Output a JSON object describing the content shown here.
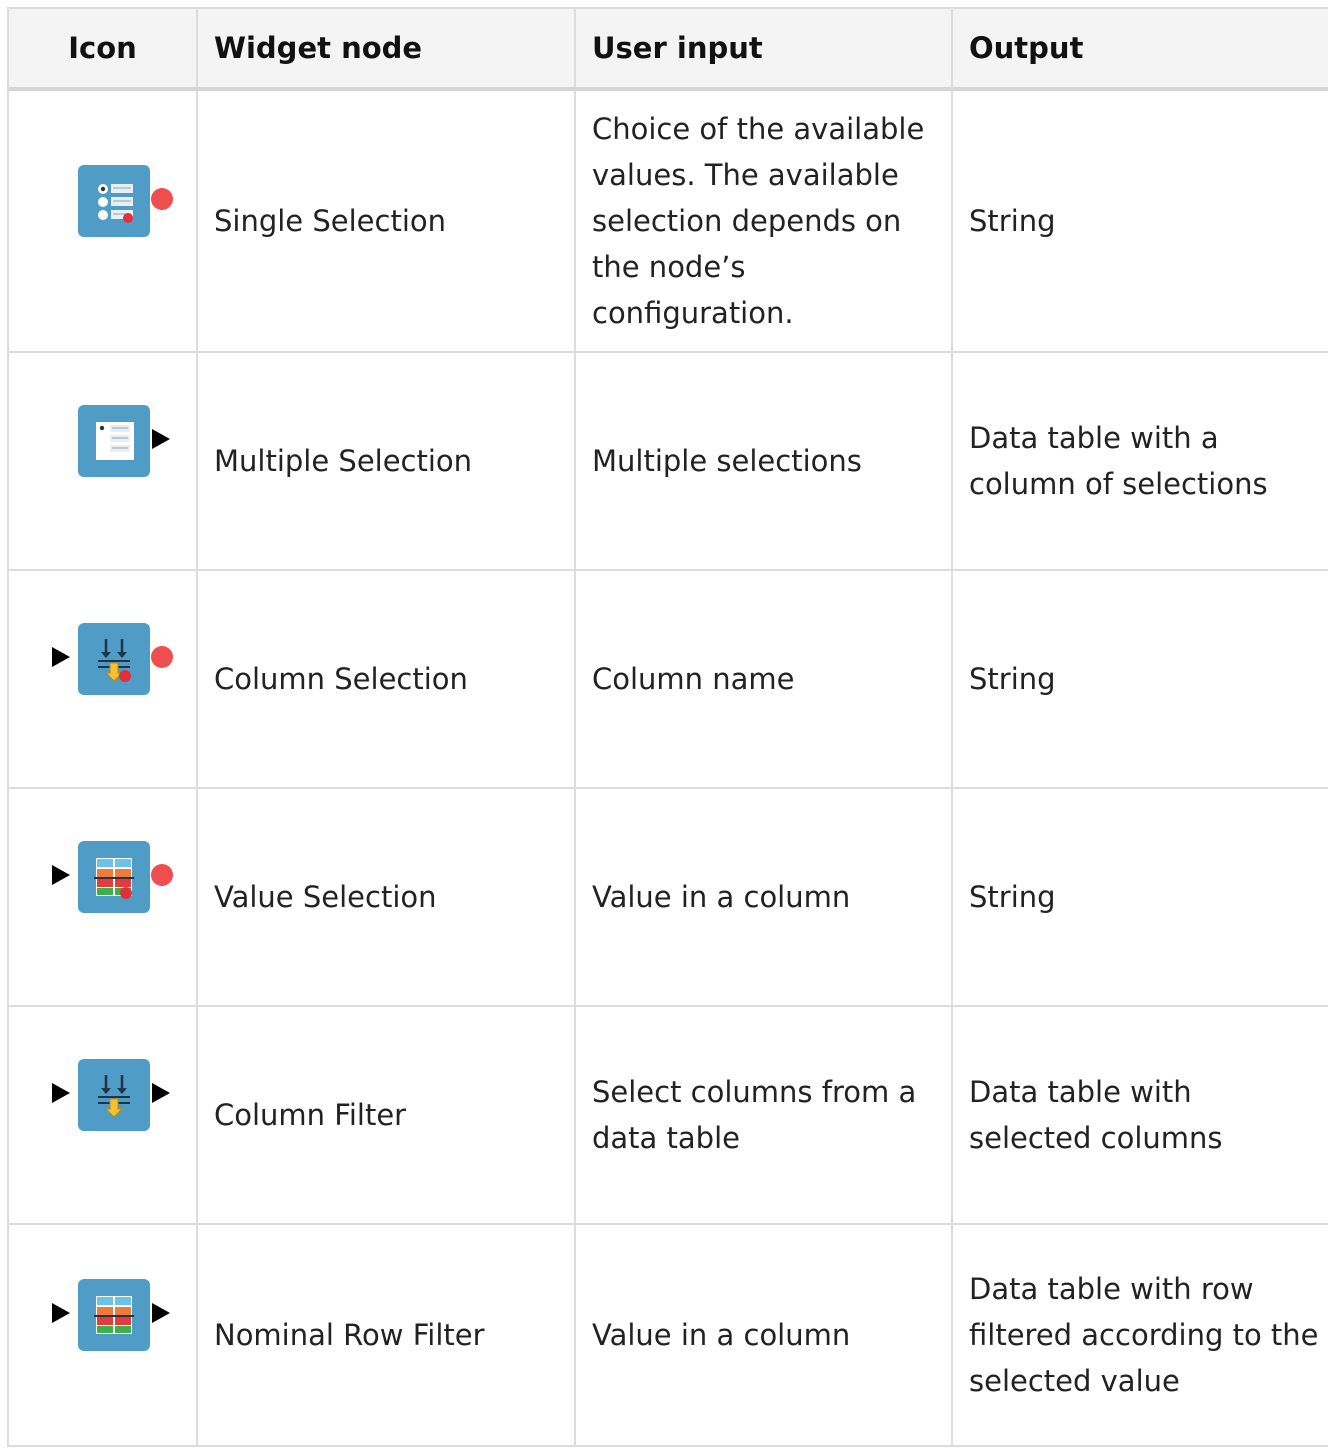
{
  "colors": {
    "node_box": "#4f9dc6",
    "flow_port": "#000000",
    "variable_port": "#f04e4e"
  },
  "table": {
    "headers": [
      "Icon",
      "Widget node",
      "User input",
      "Output"
    ],
    "rows": [
      {
        "icon": "single-selection-widget-icon",
        "name": "Single Selection",
        "input": "Choice of the available values. The available selection depends on the node’s configuration.",
        "output": "String"
      },
      {
        "icon": "multiple-selection-widget-icon",
        "name": "Multiple Selection",
        "input": "Multiple selections",
        "output": "Data table with a column of selections"
      },
      {
        "icon": "column-selection-widget-icon",
        "name": "Column Selection",
        "input": "Column name",
        "output": "String"
      },
      {
        "icon": "value-selection-widget-icon",
        "name": "Value Selection",
        "input": "Value in a column",
        "output": "String"
      },
      {
        "icon": "column-filter-widget-icon",
        "name": "Column Filter",
        "input": "Select columns from a data table",
        "output": "Data table with selected columns"
      },
      {
        "icon": "nominal-row-filter-widget-icon",
        "name": "Nominal Row Filter",
        "input": "Value in a column",
        "output": "Data table with row filtered according to the selected value"
      }
    ]
  }
}
